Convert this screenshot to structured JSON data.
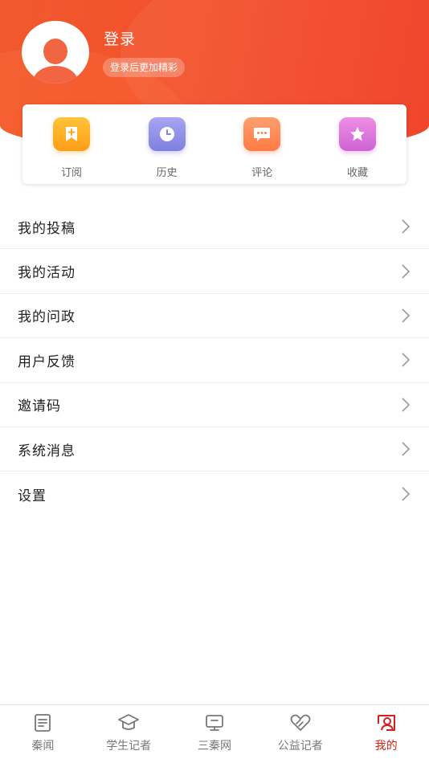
{
  "profile": {
    "login_title": "登录",
    "login_subtitle": "登录后更加精彩"
  },
  "quick_actions": [
    {
      "label": "订阅",
      "icon": "bookmark-plus-icon",
      "color": "#ffb02a"
    },
    {
      "label": "历史",
      "icon": "clock-icon",
      "color": "#8f8fe8"
    },
    {
      "label": "评论",
      "icon": "chat-bubble-icon",
      "color": "#ff8a55"
    },
    {
      "label": "收藏",
      "icon": "star-icon",
      "color": "#de76dc"
    }
  ],
  "menu": [
    {
      "label": "我的投稿"
    },
    {
      "label": "我的活动"
    },
    {
      "label": "我的问政"
    },
    {
      "label": "用户反馈"
    },
    {
      "label": "邀请码"
    },
    {
      "label": "系统消息"
    },
    {
      "label": "设置"
    }
  ],
  "tabs": [
    {
      "label": "秦闻",
      "icon": "news-icon",
      "active": false
    },
    {
      "label": "学生记者",
      "icon": "graduation-cap-icon",
      "active": false
    },
    {
      "label": "三秦网",
      "icon": "monitor-icon",
      "active": false
    },
    {
      "label": "公益记者",
      "icon": "heart-hands-icon",
      "active": false
    },
    {
      "label": "我的",
      "icon": "profile-icon",
      "active": true
    }
  ],
  "colors": {
    "brand": "#f24a27",
    "active_tab": "#d81e18",
    "text": "#222222",
    "muted": "#777777"
  }
}
